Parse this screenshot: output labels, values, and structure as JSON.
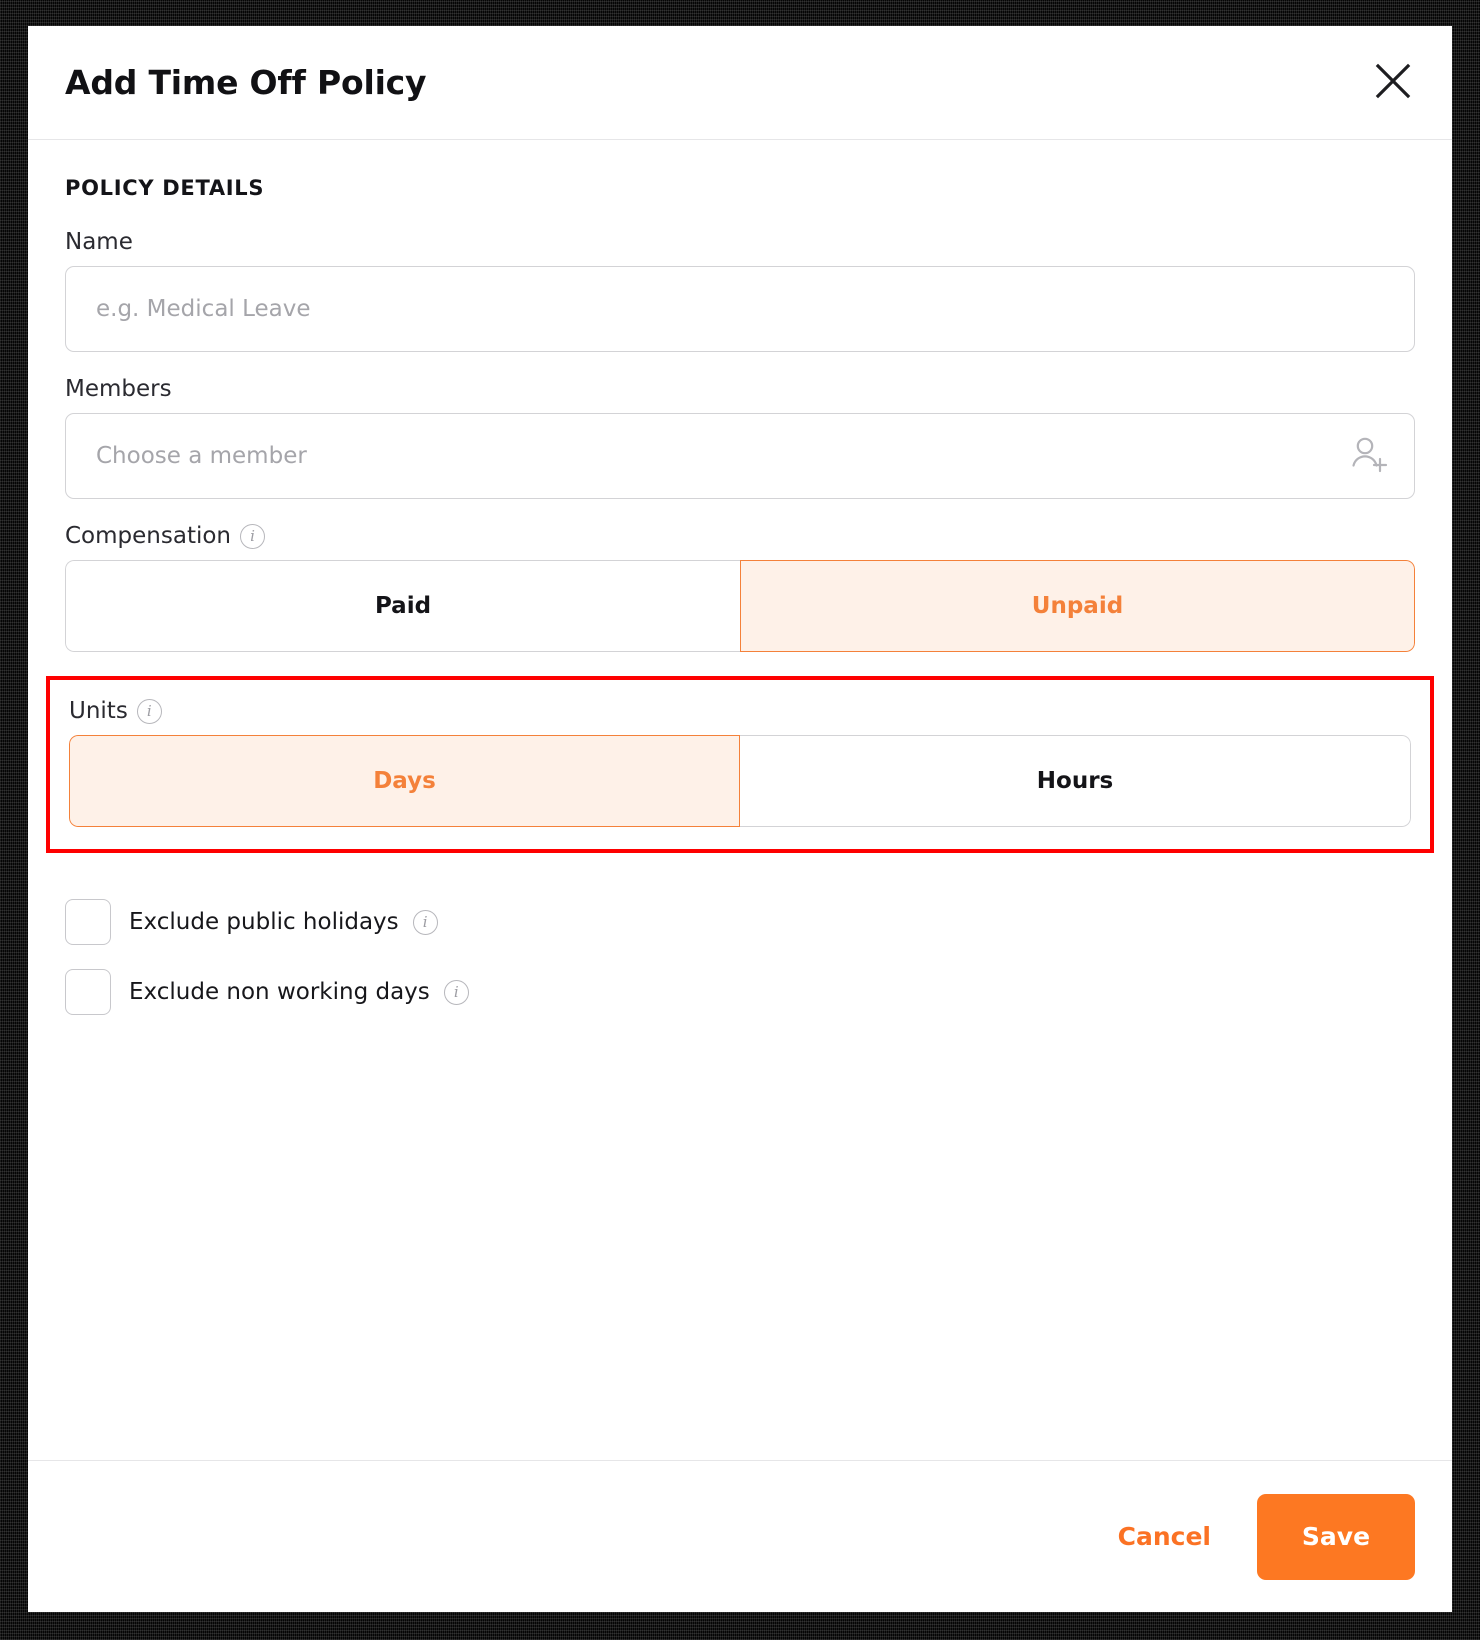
{
  "modal": {
    "title": "Add Time Off Policy",
    "close_icon": "close-icon"
  },
  "section": {
    "heading": "POLICY DETAILS"
  },
  "fields": {
    "name": {
      "label": "Name",
      "placeholder": "e.g. Medical Leave",
      "value": ""
    },
    "members": {
      "label": "Members",
      "placeholder": "Choose a member",
      "value": "",
      "icon": "person-add-icon"
    },
    "compensation": {
      "label": "Compensation",
      "info_icon": "info-icon",
      "options": [
        "Paid",
        "Unpaid"
      ],
      "selected": "Unpaid"
    },
    "units": {
      "label": "Units",
      "info_icon": "info-icon",
      "options": [
        "Days",
        "Hours"
      ],
      "selected": "Days",
      "highlighted": true
    }
  },
  "checkboxes": [
    {
      "label": "Exclude public holidays",
      "checked": false,
      "info_icon": "info-icon"
    },
    {
      "label": "Exclude non working days",
      "checked": false,
      "info_icon": "info-icon"
    }
  ],
  "footer": {
    "cancel_label": "Cancel",
    "save_label": "Save"
  },
  "colors": {
    "accent": "#fd7822",
    "accent_soft_bg": "#fef1e8",
    "accent_border": "#f4813a",
    "highlight": "#fe0000",
    "border": "#d3d3d6",
    "text": "#141418",
    "placeholder": "#a5a5aa"
  },
  "info_glyph": "i"
}
